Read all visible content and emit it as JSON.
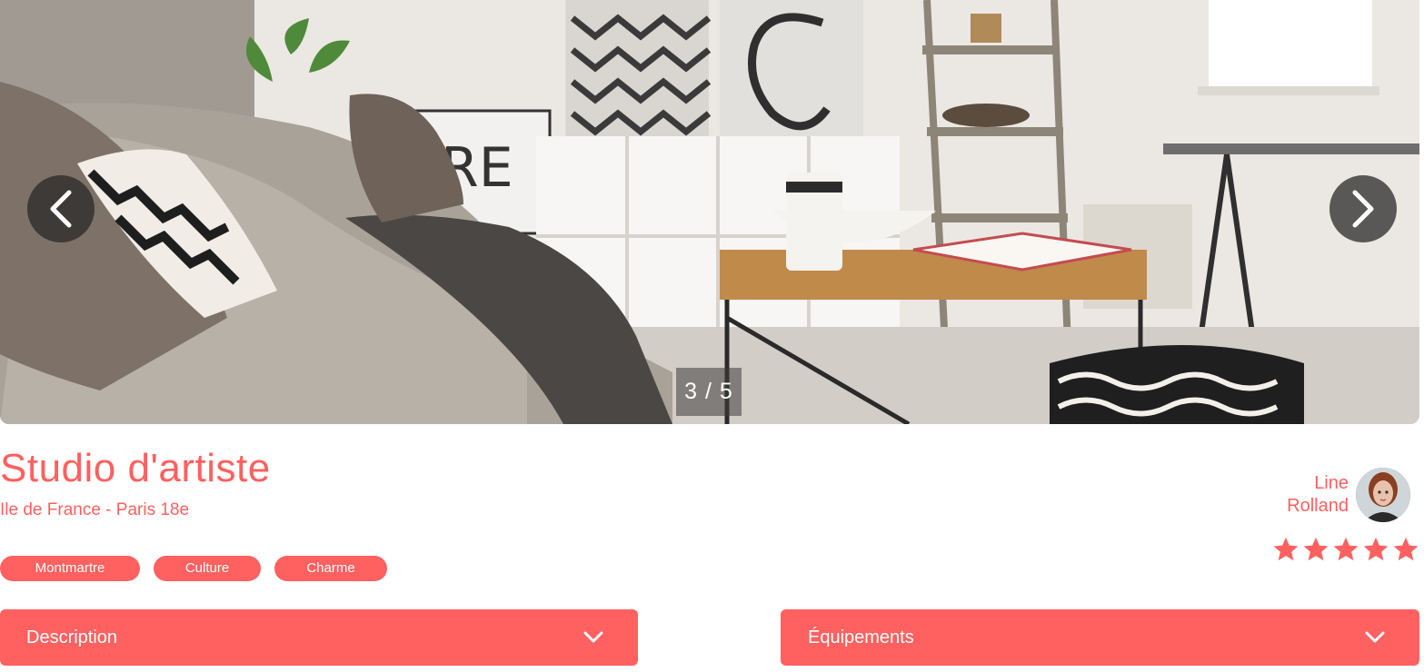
{
  "carousel": {
    "counter": "3 / 5",
    "prev_icon": "chevron-left-icon",
    "next_icon": "chevron-right-icon"
  },
  "listing": {
    "title": "Studio d'artiste",
    "location": "Ile de France - Paris 18e",
    "tags": [
      "Montmartre",
      "Culture",
      "Charme"
    ]
  },
  "host": {
    "first_name": "Line",
    "last_name": "Rolland"
  },
  "rating": {
    "value": 5,
    "max": 5
  },
  "collapsibles": {
    "description_label": "Description",
    "equipment_label": "Équipements"
  },
  "colors": {
    "accent": "#FF6060",
    "text_on_accent": "#FFFFFF"
  }
}
